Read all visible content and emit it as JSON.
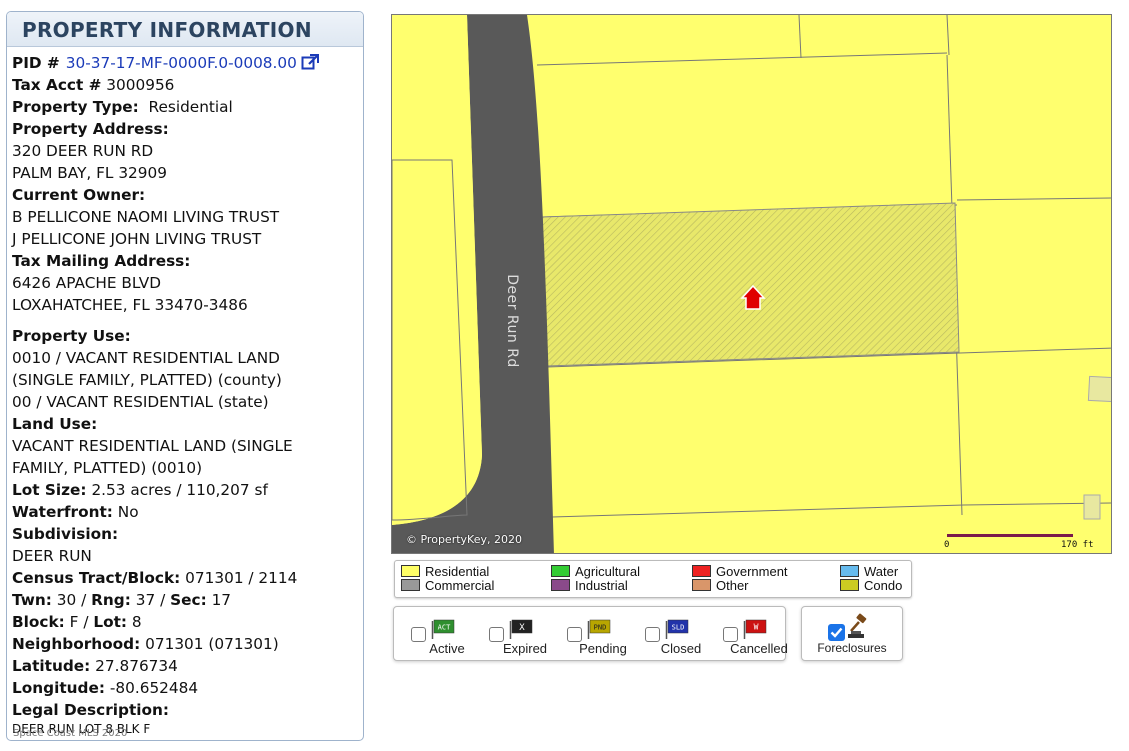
{
  "panel": {
    "title": "PROPERTY INFORMATION",
    "pid_label": "PID #",
    "pid_value": "30-37-17-MF-0000F.0-0008.00",
    "tax_acct_label": "Tax Acct #",
    "tax_acct_value": "3000956",
    "property_type_label": "Property Type:",
    "property_type_value": "Residential",
    "property_address_label": "Property Address:",
    "property_address_line1": "320 DEER RUN RD",
    "property_address_line2": "PALM BAY, FL 32909",
    "current_owner_label": "Current Owner:",
    "owner_line1": "B PELLICONE NAOMI LIVING TRUST",
    "owner_line2": "J PELLICONE JOHN LIVING TRUST",
    "tax_mailing_label": "Tax Mailing Address:",
    "tax_mailing_line1": "6426 APACHE BLVD",
    "tax_mailing_line2": "LOXAHATCHEE, FL 33470-3486",
    "property_use_label": "Property Use:",
    "property_use_line1": "0010 / VACANT RESIDENTIAL LAND",
    "property_use_line2": "(SINGLE FAMILY, PLATTED) (county)",
    "property_use_line3": "00 / VACANT RESIDENTIAL (state)",
    "land_use_label": "Land Use:",
    "land_use_line1": "VACANT RESIDENTIAL LAND (SINGLE",
    "land_use_line2": "FAMILY, PLATTED) (0010)",
    "lot_size_label": "Lot Size:",
    "lot_size_value": "2.53 acres / 110,207 sf",
    "waterfront_label": "Waterfront:",
    "waterfront_value": "No",
    "subdivision_label": "Subdivision:",
    "subdivision_value": "DEER RUN",
    "census_label": "Census Tract/Block:",
    "census_value": "071301 / 2114",
    "twn_label": "Twn:",
    "twn_value": "30 /",
    "rng_label": "Rng:",
    "rng_value": "37 /",
    "sec_label": "Sec:",
    "sec_value": "17",
    "block_label": "Block:",
    "block_value": "F /",
    "lot_label": "Lot:",
    "lot_value": "8",
    "neighborhood_label": "Neighborhood:",
    "neighborhood_value": "071301 (071301)",
    "latitude_label": "Latitude:",
    "latitude_value": "27.876734",
    "longitude_label": "Longitude:",
    "longitude_value": "-80.652484",
    "legal_label": "Legal Description:",
    "legal_value": "DEER RUN LOT 8 BLK F",
    "watermark": "Space Coast MLS 2020"
  },
  "map": {
    "road_name": "Deer Run Rd",
    "copyright": "© PropertyKey, 2020",
    "scale_start": "0",
    "scale_end": "170 ft",
    "colors": {
      "parcel": "#ffff6e",
      "road": "#595959",
      "marker": "#e00000"
    }
  },
  "legend": [
    {
      "label": "Residential",
      "color": "#ffff66"
    },
    {
      "label": "Agricultural",
      "color": "#33cc33"
    },
    {
      "label": "Government",
      "color": "#ee2222"
    },
    {
      "label": "Water",
      "color": "#66bbee"
    },
    {
      "label": "Commercial",
      "color": "#999999"
    },
    {
      "label": "Industrial",
      "color": "#8a4a8a"
    },
    {
      "label": "Other",
      "color": "#d9966a"
    },
    {
      "label": "Condo",
      "color": "#cccc22"
    }
  ],
  "filters": [
    {
      "label": "Active",
      "flag_text": "ACT",
      "flag_color": "#2f8f2f",
      "checked": false
    },
    {
      "label": "Expired",
      "flag_text": "X",
      "flag_color": "#222222",
      "checked": false
    },
    {
      "label": "Pending",
      "flag_text": "PND",
      "flag_color": "#b8a600",
      "checked": false
    },
    {
      "label": "Closed",
      "flag_text": "SLD",
      "flag_color": "#2233aa",
      "checked": false
    },
    {
      "label": "Cancelled",
      "flag_text": "W",
      "flag_color": "#cc1111",
      "checked": false
    }
  ],
  "foreclosures": {
    "label": "Foreclosures",
    "checked": true
  }
}
